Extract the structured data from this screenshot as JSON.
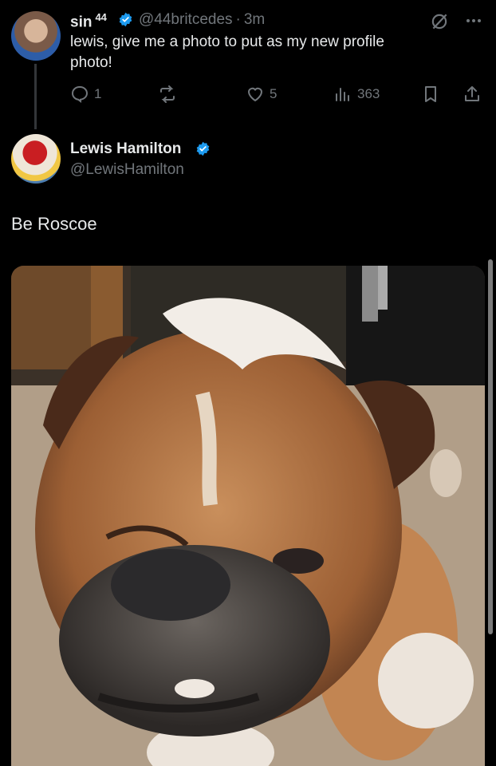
{
  "original_tweet": {
    "display_name": "sin",
    "name_superscript": "44",
    "handle": "@44britcedes",
    "separator": "·",
    "time": "3m",
    "text_line1": "lewis, give me a photo to put as my new profile",
    "text_line2": "photo!",
    "actions": {
      "replies": "1",
      "reposts": "",
      "likes": "5",
      "views": "363"
    }
  },
  "reply_tweet": {
    "display_name": "Lewis Hamilton",
    "handle": "@LewisHamilton",
    "text": "Be Roscoe"
  },
  "colors": {
    "background": "#000000",
    "text": "#e7e9ea",
    "muted": "#71767b",
    "verified": "#1d9bf0"
  },
  "icons": {
    "reply": "reply-icon",
    "repost": "repost-icon",
    "like": "heart-icon",
    "views": "views-icon",
    "bookmark": "bookmark-icon",
    "share": "share-icon",
    "grok": "grok-icon",
    "more": "more-icon"
  }
}
